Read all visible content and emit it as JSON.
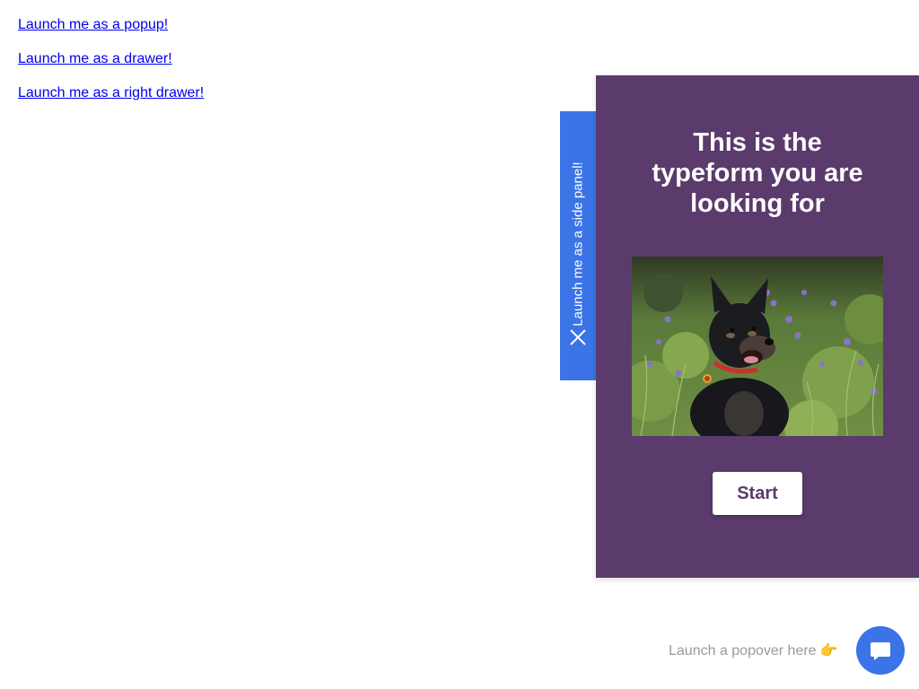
{
  "links": {
    "popup": "Launch me as a popup!",
    "drawer": "Launch me as a drawer!",
    "right_drawer": "Launch me as a right drawer!"
  },
  "side_panel": {
    "tab_label": "Launch me as a side panel!",
    "tab_color": "#3a74e6",
    "close_icon": "close-icon"
  },
  "typeform": {
    "title": "This is the\ntypeform you are\nlooking for",
    "image_alt": "black dog in wildflower meadow",
    "start_label": "Start",
    "background_color": "#5b3a6c"
  },
  "popover": {
    "label": "Launch a popover here",
    "emoji": "👉",
    "button_icon": "chat-bubble-icon",
    "button_color": "#3a74e6"
  }
}
